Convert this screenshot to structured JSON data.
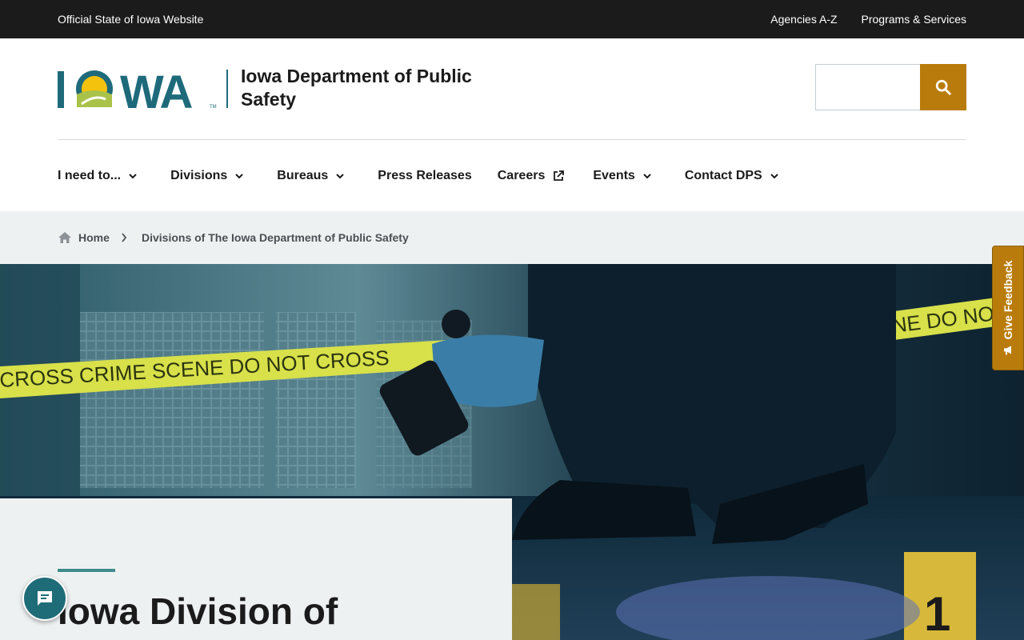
{
  "topbar": {
    "official_label": "Official State of Iowa Website",
    "links": [
      "Agencies A-Z",
      "Programs & Services"
    ]
  },
  "header": {
    "logo_text": "IOWA",
    "department_title": "Iowa Department of Public Safety",
    "search": {
      "value": "",
      "placeholder": "",
      "icon": "search-icon"
    }
  },
  "nav": {
    "items": [
      {
        "label": "I need to...",
        "icon": "chevron-down-icon"
      },
      {
        "label": "Divisions",
        "icon": "chevron-down-icon"
      },
      {
        "label": "Bureaus",
        "icon": "chevron-down-icon"
      },
      {
        "label": "Press Releases"
      },
      {
        "label": "Careers",
        "icon": "external-link-icon"
      },
      {
        "label": "Events",
        "icon": "chevron-down-icon"
      },
      {
        "label": "Contact DPS",
        "icon": "chevron-down-icon"
      }
    ]
  },
  "breadcrumb": {
    "home": "Home",
    "current": "Divisions of The Iowa Department of Public Safety"
  },
  "hero": {
    "tape_text": "CROSS CRIME SCENE DO NOT CROSS",
    "tape_text_2": "NE DO NO",
    "marker_number": "1",
    "title": "Iowa Division of"
  },
  "feedback": {
    "label": "Give Feedback",
    "icon": "megaphone-icon"
  },
  "chat": {
    "icon": "chat-bubble-icon"
  },
  "colors": {
    "topbar": "#1b1b1b",
    "accent_gold": "#b97c0c",
    "brand_teal": "#1e6a7b",
    "accent_green": "#3f8c8a",
    "breadcrumb_bg": "#eef1f2"
  }
}
